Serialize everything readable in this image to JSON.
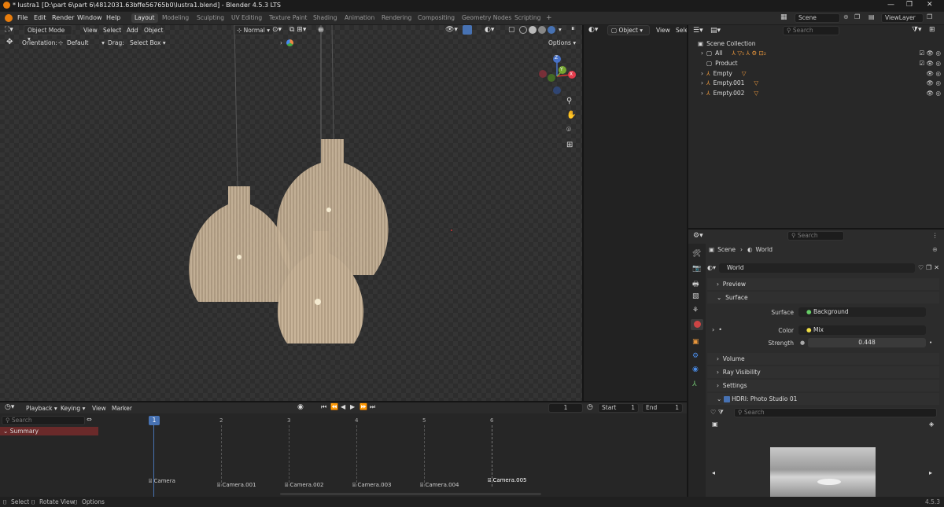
{
  "window": {
    "title": "* lustra1 [D:\\part 6\\part 6\\4812031.63bffe56765b0\\lustra1.blend] - Blender 4.5.3 LTS"
  },
  "menu": [
    "File",
    "Edit",
    "Render",
    "Window",
    "Help"
  ],
  "workspaces": [
    "Layout",
    "Modeling",
    "Sculpting",
    "UV Editing",
    "Texture Paint",
    "Shading",
    "Animation",
    "Rendering",
    "Compositing",
    "Geometry Nodes",
    "Scripting"
  ],
  "active_workspace": "Layout",
  "add_tab": "+",
  "scene_field": "Scene",
  "viewlayer_field": "ViewLayer",
  "viewport": {
    "mode": "Object Mode",
    "menus": [
      "View",
      "Select",
      "Add",
      "Object"
    ],
    "orientation_label": "Orientation:",
    "orientation_value": "Default",
    "drag_label": "Drag:",
    "drag_value": "Select Box",
    "transform_value": "Normal",
    "options_label": "Options",
    "gizmo_x": "X",
    "gizmo_y": "Y",
    "gizmo_z": "Z"
  },
  "midview": {
    "mode": "Object",
    "view": "View",
    "select": "Sele"
  },
  "outliner": {
    "search_placeholder": "Search",
    "items": [
      {
        "label": "Scene Collection"
      },
      {
        "label": "All"
      },
      {
        "label": "Product"
      },
      {
        "label": "Empty"
      },
      {
        "label": "Empty.001"
      },
      {
        "label": "Empty.002"
      }
    ]
  },
  "properties": {
    "search_placeholder": "Search",
    "breadcrumb_scene": "Scene",
    "breadcrumb_world": "World",
    "world_name": "World",
    "panels": {
      "preview": "Preview",
      "surface": "Surface",
      "volume": "Volume",
      "ray_visibility": "Ray Visibility",
      "settings": "Settings",
      "hdri": "HDRI: Photo Studio 01"
    },
    "surface_label": "Surface",
    "surface_value": "Background",
    "color_label": "Color",
    "color_value": "Mix",
    "strength_label": "Strength",
    "strength_value": "0.448",
    "hdri_search_placeholder": "Search"
  },
  "timeline": {
    "menus": [
      "Playback",
      "Keying",
      "View",
      "Marker"
    ],
    "current_frame": "1",
    "start_label": "Start",
    "start_value": "1",
    "end_label": "End",
    "end_value": "1",
    "search_placeholder": "Search",
    "summary_label": "Summary",
    "frame_numbers": [
      "1",
      "2",
      "3",
      "4",
      "5",
      "6"
    ],
    "markers": [
      "Camera",
      "Camera.001",
      "Camera.002",
      "Camera.003",
      "Camera.004",
      "Camera.005"
    ]
  },
  "status": {
    "select": "Select",
    "rotate": "Rotate View",
    "options": "Options",
    "version": "4.5.3"
  },
  "colors": {
    "accent": "#4772b3",
    "outliner_orange": "#e8963c",
    "summary_red": "#6a2a2a"
  }
}
